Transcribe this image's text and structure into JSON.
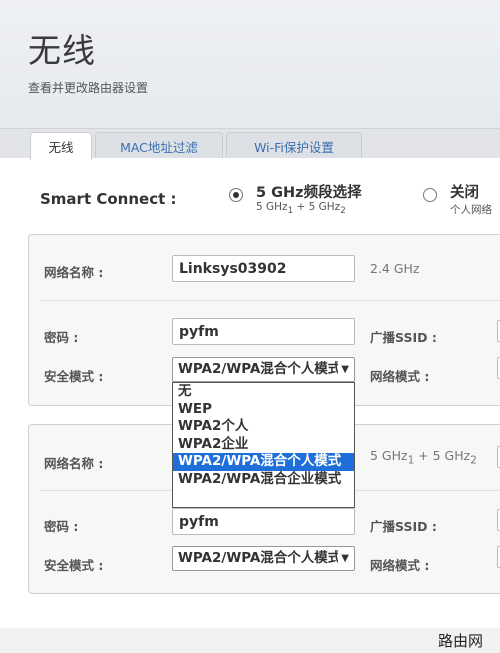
{
  "page": {
    "title": "无线",
    "subtitle": "查看并更改路由器设置"
  },
  "tabs": [
    {
      "label": "无线",
      "active": true
    },
    {
      "label": "MAC地址过滤",
      "active": false
    },
    {
      "label": "Wi-Fi保护设置",
      "active": false
    }
  ],
  "smart_connect": {
    "label": "Smart Connect :",
    "option1": {
      "title": "5 GHz频段选择",
      "sub": "5 GHz1 + 5 GHz2",
      "checked": true
    },
    "option2": {
      "title": "关闭",
      "sub": "个人网络",
      "checked": false
    }
  },
  "panel1": {
    "network_name_label": "网络名称 :",
    "network_name": "Linksys03902",
    "band": "2.4 GHz",
    "password_label": "密码 :",
    "password": "pyfm",
    "broadcast_label": "广播SSID :",
    "security_label": "安全模式 :",
    "security_value": "WPA2/WPA混合个人模式",
    "network_mode_label": "网络模式 :"
  },
  "dropdown": {
    "options": [
      "无",
      "WEP",
      "WPA2个人",
      "WPA2企业",
      "WPA2/WPA混合个人模式",
      "WPA2/WPA混合企业模式"
    ],
    "selected_index": 4
  },
  "panel2": {
    "network_name_label": "网络名称 :",
    "band": "5 GHz1 + 5 GHz2",
    "password_label": "密码 :",
    "password": "pyfm",
    "broadcast_label": "广播SSID :",
    "security_label": "安全模式 :",
    "security_value": "WPA2/WPA混合个人模式",
    "network_mode_label": "网络模式 :"
  },
  "watermark": "路由网"
}
